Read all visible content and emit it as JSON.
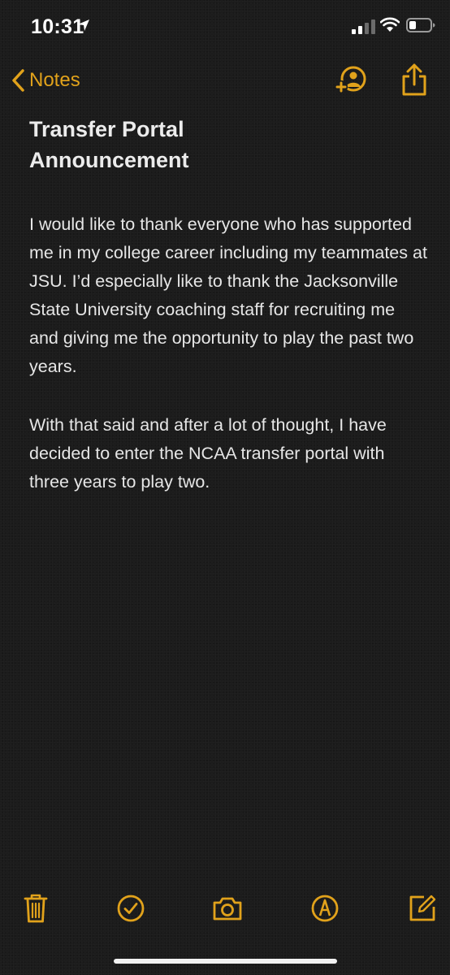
{
  "status_bar": {
    "time": "10:31",
    "icons": [
      "location-arrow-icon",
      "cellular-signal-icon",
      "wifi-icon",
      "battery-icon"
    ]
  },
  "nav": {
    "back_label": "Notes",
    "actions": [
      "add-person-icon",
      "share-icon"
    ]
  },
  "note": {
    "title": "Transfer Portal Announcement",
    "paragraphs": [
      "I would like to thank everyone who has supported me in my college career including my teammates at JSU.  I’d especially like to thank the Jacksonville State University coaching staff for recruiting me and giving me the opportunity to play the past two years.",
      "With that said and after a lot of thought, I have decided to enter the NCAA transfer portal with three years to play two."
    ]
  },
  "toolbar": {
    "items": [
      "trash-icon",
      "checklist-icon",
      "camera-icon",
      "markup-pen-icon",
      "compose-icon"
    ]
  },
  "colors": {
    "accent": "#e1a21b",
    "background": "#1c1c1c",
    "text": "#ececec"
  }
}
